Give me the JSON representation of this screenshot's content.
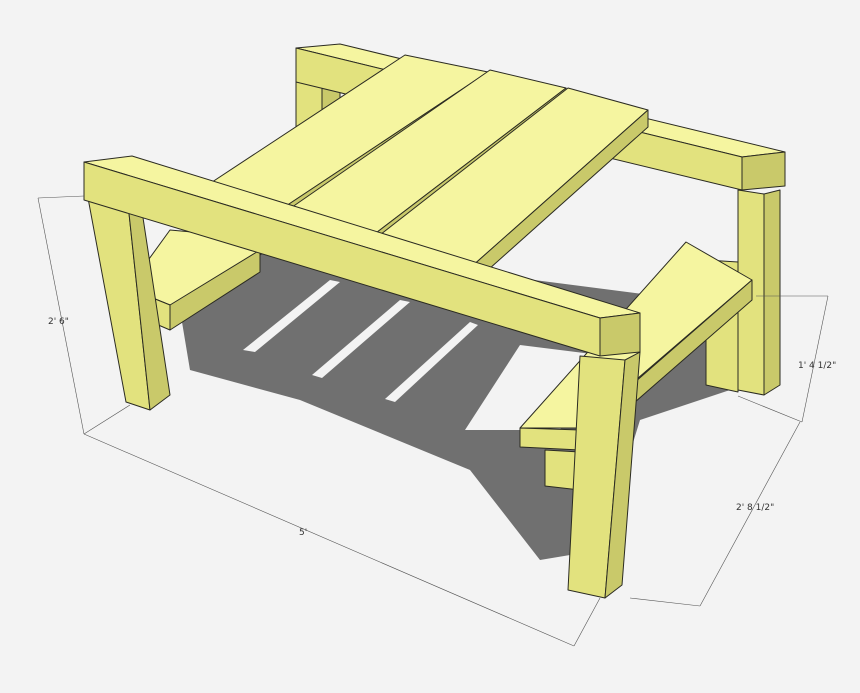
{
  "colors": {
    "background": "#f3f3f3",
    "wood_top": "#f5f5a0",
    "wood_front": "#e2e27e",
    "wood_side": "#c9c96a",
    "edge": "#2b2b22",
    "shadow": "#6f6f6f",
    "dimension_line": "#555555"
  },
  "dimensions": {
    "height": "2' 6\"",
    "length": "5'",
    "bench_height": "1' 4 1/2\"",
    "bench_depth": "2' 8 1/2\""
  }
}
